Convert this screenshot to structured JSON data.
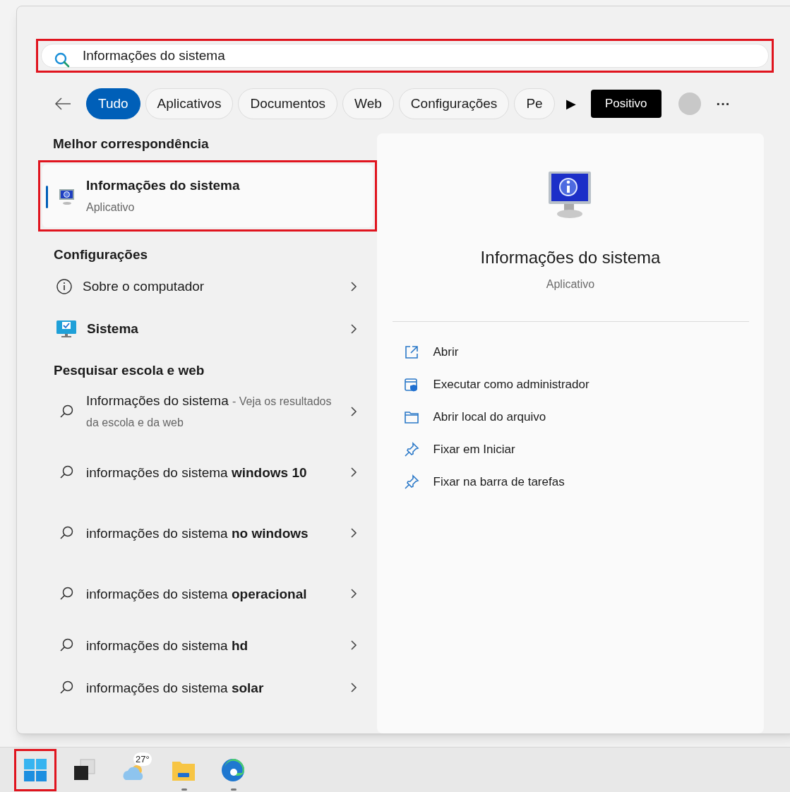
{
  "search": {
    "value": "Informações do sistema",
    "highlighted": true
  },
  "filters": [
    {
      "label": "Tudo",
      "selected": true
    },
    {
      "label": "Aplicativos",
      "selected": false
    },
    {
      "label": "Documentos",
      "selected": false
    },
    {
      "label": "Web",
      "selected": false
    },
    {
      "label": "Configurações",
      "selected": false
    },
    {
      "label": "Pe",
      "selected": false
    }
  ],
  "more_filters": "▶",
  "account": {
    "label": "Positivo"
  },
  "more_options": "···",
  "best_match": {
    "heading": "Melhor correspondência",
    "title": "Informações do sistema",
    "subtitle": "Aplicativo",
    "selected": true,
    "highlighted": true
  },
  "settings": {
    "heading": "Configurações",
    "items": [
      {
        "kind": "info",
        "label": "Sobre o computador",
        "bold": false
      },
      {
        "kind": "system",
        "label": "Sistema",
        "bold": true
      }
    ]
  },
  "web": {
    "heading": "Pesquisar escola e web",
    "items": [
      {
        "text": "Informações do sistema",
        "note": "- Veja os resultados da escola e da web"
      },
      {
        "text": "informações do sistema **windows 10**"
      },
      {
        "text": "informações do sistema **no windows**"
      },
      {
        "text": "informações do sistema **operacional**"
      },
      {
        "text": "informações do sistema **hd**"
      },
      {
        "text": "informações do sistema **solar**"
      }
    ]
  },
  "preview": {
    "title": "Informações do sistema",
    "subtitle": "Aplicativo",
    "actions": [
      {
        "kind": "open",
        "label": "Abrir"
      },
      {
        "kind": "admin",
        "label": "Executar como administrador"
      },
      {
        "kind": "folder",
        "label": "Abrir local do arquivo"
      },
      {
        "kind": "pin",
        "label": "Fixar em Iniciar"
      },
      {
        "kind": "pin",
        "label": "Fixar na barra de tarefas"
      }
    ]
  },
  "taskbar": [
    {
      "kind": "start",
      "highlighted": true,
      "running": false
    },
    {
      "kind": "taskview",
      "highlighted": false,
      "running": false
    },
    {
      "kind": "weather",
      "badge": "27°",
      "highlighted": false,
      "running": false
    },
    {
      "kind": "explorer",
      "highlighted": false,
      "running": true
    },
    {
      "kind": "edge",
      "highlighted": false,
      "running": true
    }
  ]
}
